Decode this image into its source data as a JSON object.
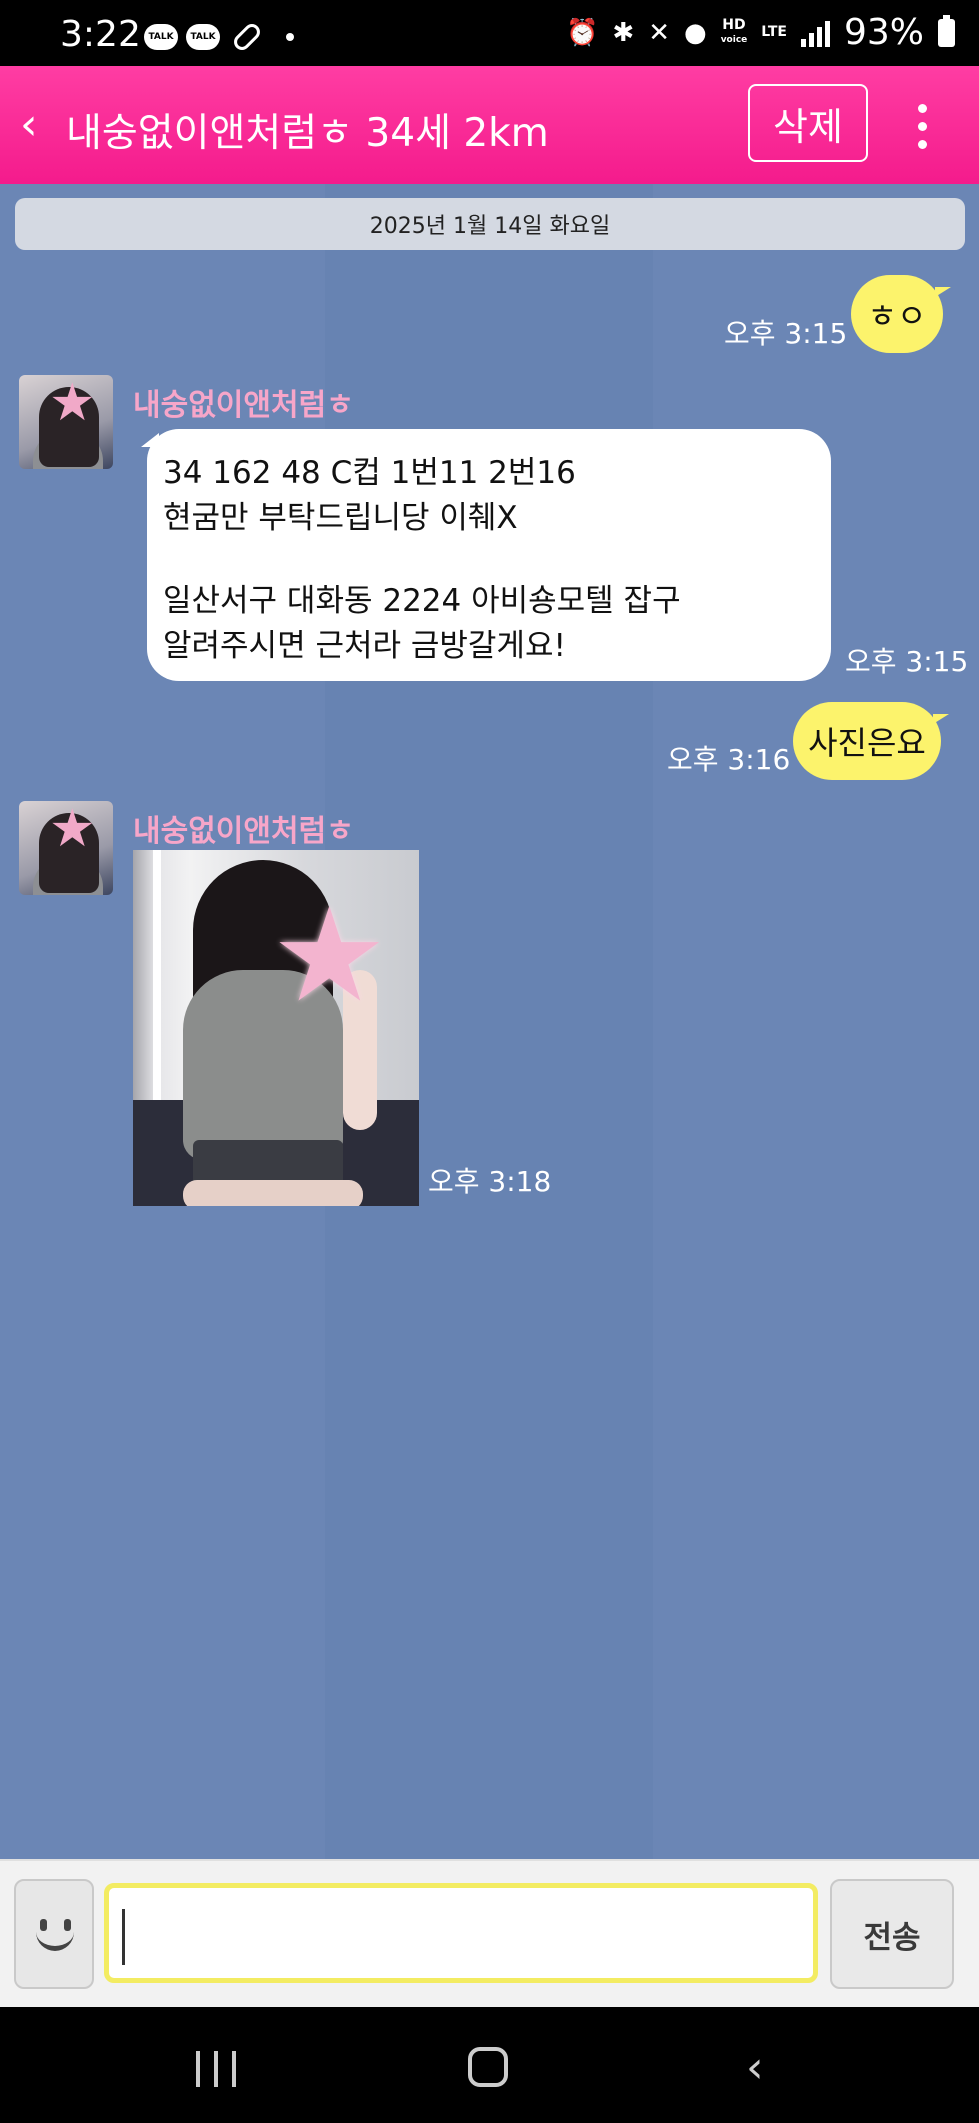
{
  "status_bar": {
    "time": "3:22",
    "notif_app": "TALK",
    "hd_top": "HD",
    "hd_bottom": "voice",
    "lte": "LTE",
    "battery": "93%"
  },
  "header": {
    "back_icon": "‹",
    "title": "내숭없이앤처럼ㅎ 34세 2km",
    "delete_label": "삭제",
    "accent_color": "#f41b8c"
  },
  "chat": {
    "date_divider": "2025년 1월 14일 화요일",
    "messages": [
      {
        "from": "me",
        "text": "ㅎㅇ",
        "time": "오후 3:15"
      },
      {
        "from": "them",
        "sender": "내숭없이앤처럼ㅎ",
        "lines": [
          "34 162 48 C컵 1번11 2번16",
          "현굼만 부탁드립니당 이췌X",
          "일산서구 대화동 2224 아비숑모텔 잡구",
          "알려주시면 근처라 금방갈게요!"
        ],
        "time": "오후 3:15"
      },
      {
        "from": "me",
        "text": "사진은요",
        "time": "오후 3:16"
      },
      {
        "from": "them",
        "sender": "내숭없이앤처럼ㅎ",
        "type": "photo",
        "time": "오후 3:18"
      }
    ]
  },
  "input": {
    "value": "",
    "send_label": "전송"
  }
}
